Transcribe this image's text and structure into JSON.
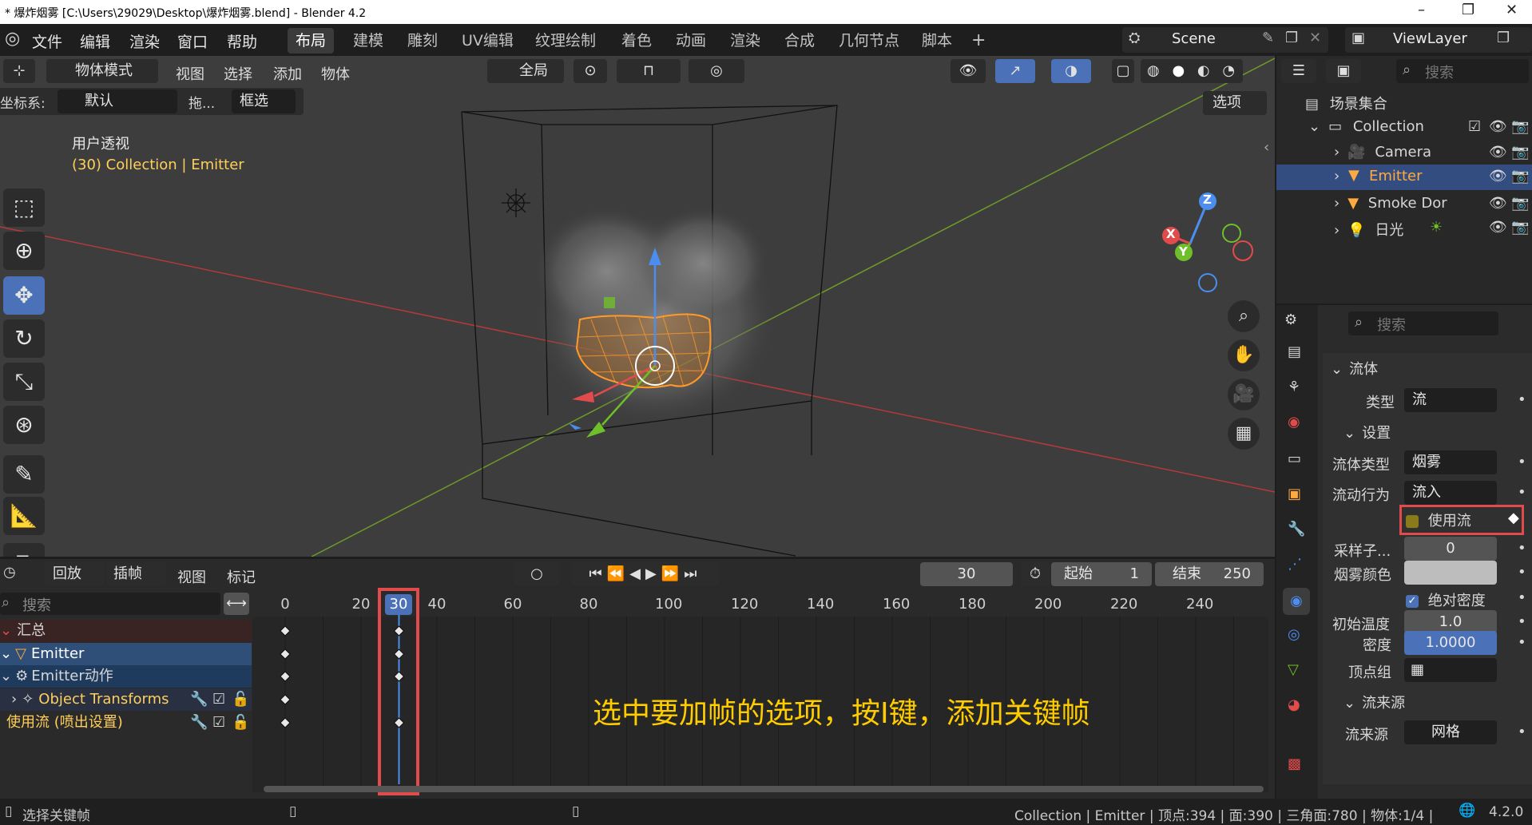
{
  "title_bar": {
    "title": "* 爆炸烟雾 [C:\\Users\\29029\\Desktop\\爆炸烟雾.blend] - Blender 4.2",
    "minimize": "–",
    "restore": "❐",
    "close": "✕"
  },
  "menu": {
    "file": "文件",
    "edit": "编辑",
    "render": "渲染",
    "window": "窗口",
    "help": "帮助"
  },
  "workspaces": [
    "布局",
    "建模",
    "雕刻",
    "UV编辑",
    "纹理绘制",
    "着色",
    "动画",
    "渲染",
    "合成",
    "几何节点",
    "脚本"
  ],
  "add_tab": "+",
  "scene": {
    "name": "Scene",
    "view_layer": "ViewLayer"
  },
  "viewport": {
    "mode": "物体模式",
    "view": "视图",
    "select": "选择",
    "add": "添加",
    "object": "物体",
    "transform_orientation": "全局",
    "coord_label": "坐标系:",
    "coord_value": "默认",
    "drag_label": "拖...",
    "drag_value": "框选",
    "options": "选项",
    "info_view": "用户透视",
    "info_object": "(30) Collection | Emitter",
    "gizmo": {
      "z": "Z",
      "x": "X",
      "y": "Y"
    }
  },
  "timeline": {
    "playback": "回放",
    "keying": "插帧",
    "view": "视图",
    "marker": "标记",
    "current_frame": "30",
    "start_label": "起始",
    "start": "1",
    "end_label": "结束",
    "end": "250",
    "search_placeholder": "搜索",
    "ruler": [
      "0",
      "20",
      "30",
      "40",
      "60",
      "80",
      "100",
      "120",
      "140",
      "160",
      "180",
      "200",
      "220",
      "240"
    ],
    "channels": [
      {
        "label": "汇总"
      },
      {
        "label": "Emitter"
      },
      {
        "label": "Emitter动作"
      },
      {
        "label": "Object Transforms"
      },
      {
        "label": "使用流 (喷出设置)"
      }
    ],
    "annotation": "选中要加帧的选项，按I键，添加关键帧"
  },
  "outliner": {
    "search_placeholder": "搜索",
    "scene_collection": "场景集合",
    "items": [
      {
        "name": "Collection"
      },
      {
        "name": "Camera"
      },
      {
        "name": "Emitter"
      },
      {
        "name": "Smoke Dor"
      },
      {
        "name": "日光"
      }
    ]
  },
  "properties": {
    "search_placeholder": "搜索",
    "fluid_section": "流体",
    "type_label": "类型",
    "type_value": "流",
    "settings_section": "设置",
    "flow_type_label": "流体类型",
    "flow_type_value": "烟雾",
    "flow_behavior_label": "流动行为",
    "flow_behavior_value": "流入",
    "use_flow_label": "使用流",
    "subframes_label": "采样子...",
    "subframes_value": "0",
    "smoke_color_label": "烟雾颜色",
    "absolute_density_label": "绝对密度",
    "initial_temp_label": "初始温度",
    "initial_temp_value": "1.0",
    "density_label": "密度",
    "density_value": "1.0000",
    "vertex_group_label": "顶点组",
    "flow_source_section": "流来源",
    "flow_source_label": "流来源",
    "flow_source_value": "网格"
  },
  "status_bar": {
    "left": "选择关键帧",
    "right": "Collection | Emitter | 顶点:394 | 面:390 | 三角面:780 | 物体:1/4 |",
    "version": "4.2.0"
  },
  "colors": {
    "accent": "#4b72b8",
    "highlight": "#e24b4b",
    "annotation": "#ffcc00",
    "active_object": "#ffaa3c"
  }
}
